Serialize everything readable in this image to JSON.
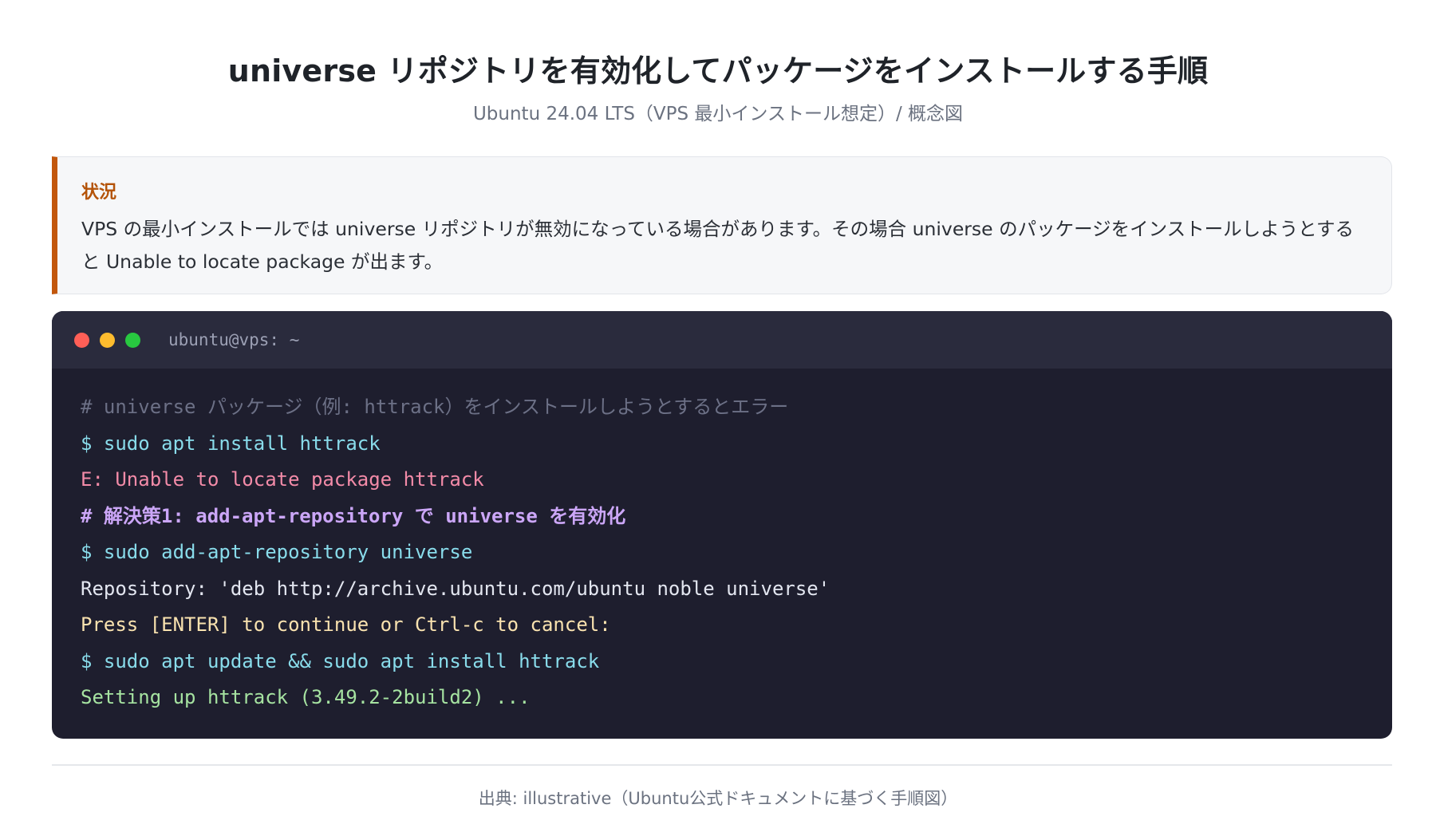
{
  "header": {
    "title": "universe リポジトリを有効化してパッケージをインストールする手順",
    "subtitle": "Ubuntu 24.04 LTS（VPS 最小インストール想定）/ 概念図"
  },
  "callout": {
    "label": "状況",
    "body": "VPS の最小インストールでは universe リポジトリが無効になっている場合があります。その場合 universe のパッケージをインストールしようとすると Unable to locate package が出ます。",
    "accent_color": "#c2570c"
  },
  "terminal": {
    "title": "ubuntu@vps: ~",
    "background_color": "#1e1e2e",
    "lines": [
      {
        "kind": "comment",
        "text": "# universe パッケージ（例: httrack）をインストールしようとするとエラー"
      },
      {
        "kind": "cmd",
        "text": "$ sudo apt install httrack"
      },
      {
        "kind": "error",
        "text": "E: Unable to locate package httrack"
      },
      {
        "kind": "heading",
        "text": "# 解決策1: add-apt-repository で universe を有効化"
      },
      {
        "kind": "cmd",
        "text": "$ sudo add-apt-repository universe"
      },
      {
        "kind": "out",
        "text": "Repository: 'deb http://archive.ubuntu.com/ubuntu noble universe'"
      },
      {
        "kind": "prompt",
        "text": "Press [ENTER] to continue or Ctrl-c to cancel:"
      },
      {
        "kind": "cmd",
        "text": "$ sudo apt update && sudo apt install httrack"
      },
      {
        "kind": "success",
        "text": "Setting up httrack (3.49.2-2build2) ..."
      }
    ]
  },
  "footer": {
    "source": "出典: illustrative（Ubuntu公式ドキュメントに基づく手順図）"
  }
}
